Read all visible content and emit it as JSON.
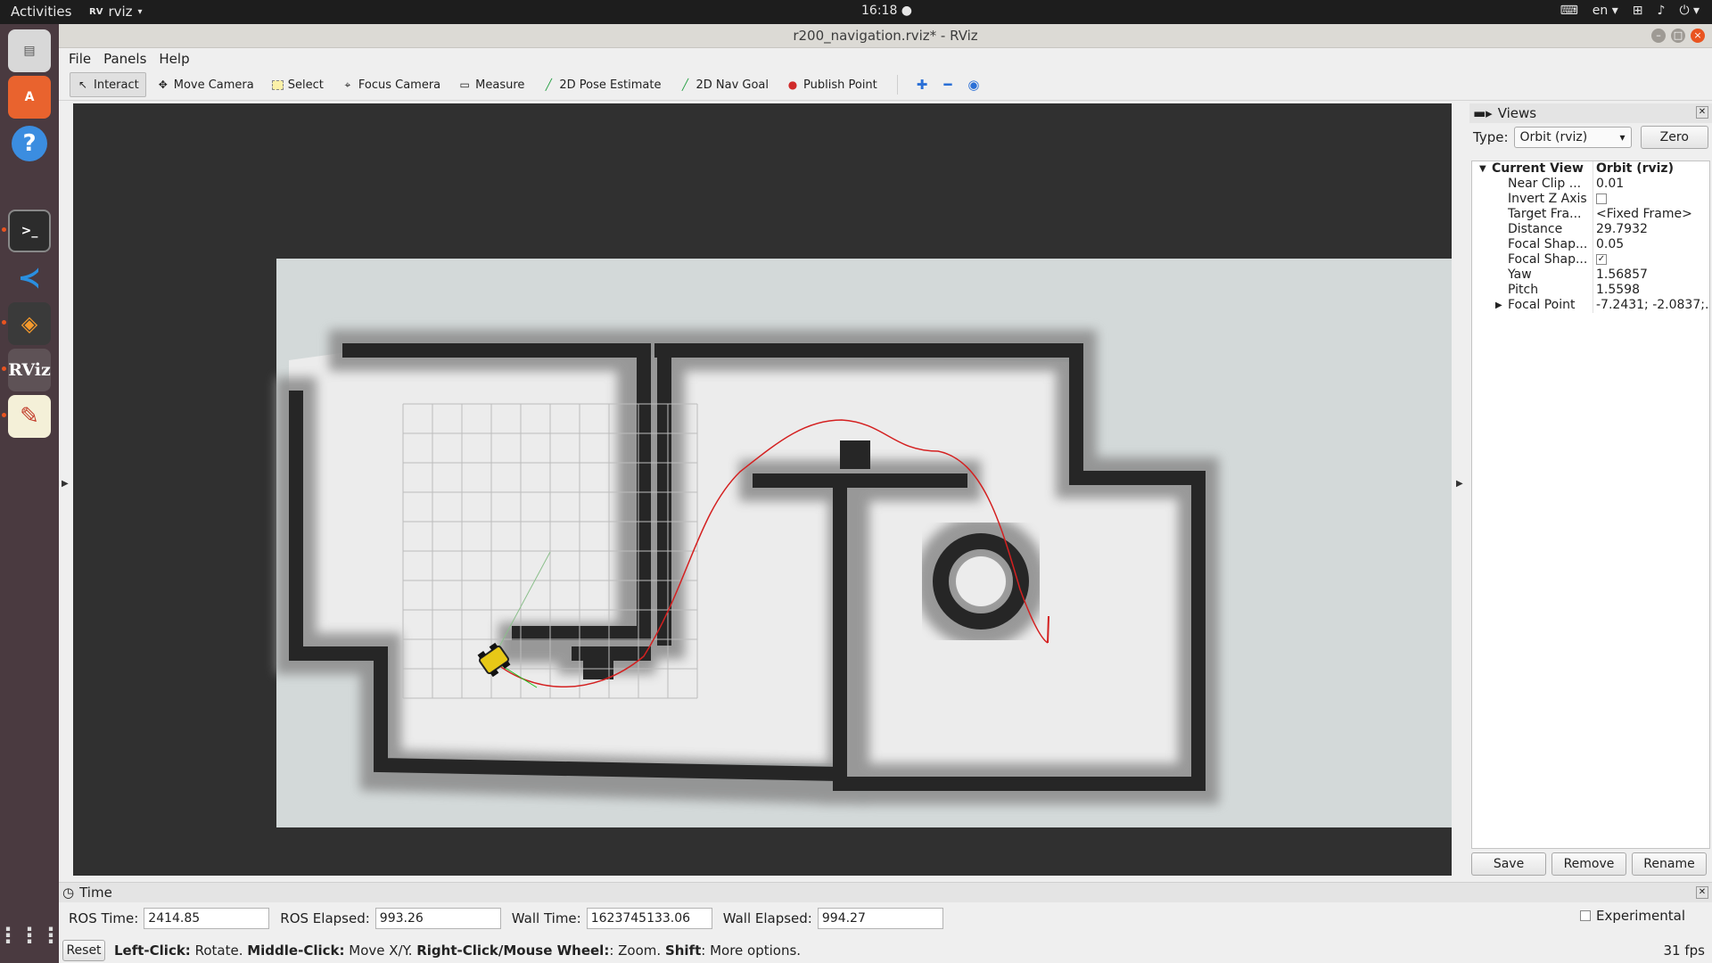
{
  "topbar": {
    "activities": "Activities",
    "app_name": "rviz",
    "clock": "16:18",
    "lang": "en"
  },
  "dock": {
    "items": [
      "files-icon",
      "software-center-icon",
      "help-icon",
      "terminal-icon",
      "vscode-icon",
      "sublime-icon",
      "rviz-icon",
      "text-editor-icon"
    ],
    "apps_grid": "show-applications-icon"
  },
  "window": {
    "title": "r200_navigation.rviz* - RViz"
  },
  "menu": [
    "File",
    "Panels",
    "Help"
  ],
  "toolbar": {
    "tools": [
      {
        "label": "Interact",
        "icon": "cursor-icon",
        "active": true
      },
      {
        "label": "Move Camera",
        "icon": "move-camera-icon",
        "active": false
      },
      {
        "label": "Select",
        "icon": "select-icon",
        "active": false
      },
      {
        "label": "Focus Camera",
        "icon": "focus-camera-icon",
        "active": false
      },
      {
        "label": "Measure",
        "icon": "ruler-icon",
        "active": false
      },
      {
        "label": "2D Pose Estimate",
        "icon": "pose-estimate-icon",
        "active": false
      },
      {
        "label": "2D Nav Goal",
        "icon": "nav-goal-icon",
        "active": false
      },
      {
        "label": "Publish Point",
        "icon": "map-pin-icon",
        "active": false
      }
    ]
  },
  "views": {
    "title": "Views",
    "type_label": "Type:",
    "type_value": "Orbit (rviz)",
    "zero": "Zero",
    "current_view": {
      "name": "Current View",
      "value": "Orbit (rviz)"
    },
    "props": [
      {
        "name": "Near Clip ...",
        "value": "0.01",
        "check": null
      },
      {
        "name": "Invert Z Axis",
        "value": "",
        "check": false
      },
      {
        "name": "Target Fra...",
        "value": "<Fixed Frame>",
        "check": null
      },
      {
        "name": "Distance",
        "value": "29.7932",
        "check": null
      },
      {
        "name": "Focal Shap...",
        "value": "0.05",
        "check": null
      },
      {
        "name": "Focal Shap...",
        "value": "",
        "check": true
      },
      {
        "name": "Yaw",
        "value": "1.56857",
        "check": null
      },
      {
        "name": "Pitch",
        "value": "1.5598",
        "check": null
      },
      {
        "name": "Focal Point",
        "value": "-7.2431; -2.0837;...",
        "check": null,
        "expandable": true
      }
    ],
    "save": "Save",
    "remove": "Remove",
    "rename": "Rename"
  },
  "time": {
    "title": "Time",
    "ros_time_label": "ROS Time:",
    "ros_time": "2414.85",
    "ros_elapsed_label": "ROS Elapsed:",
    "ros_elapsed": "993.26",
    "wall_time_label": "Wall Time:",
    "wall_time": "1623745133.06",
    "wall_elapsed_label": "Wall Elapsed:",
    "wall_elapsed": "994.27",
    "experimental": "Experimental"
  },
  "status": {
    "reset": "Reset",
    "b1": "Left-Click:",
    "t1": " Rotate. ",
    "b2": "Middle-Click:",
    "t2": " Move X/Y. ",
    "b3": "Right-Click/Mouse Wheel:",
    "t3": ": Zoom. ",
    "b4": "Shift",
    "t4": ": More options.",
    "fps": "31 fps"
  },
  "colors": {
    "accent": "#e95420",
    "render_bg": "#303030",
    "map_free": "#ececec",
    "map_unknown": "#d3d9d9",
    "wall": "#262626",
    "path": "#d42020"
  }
}
